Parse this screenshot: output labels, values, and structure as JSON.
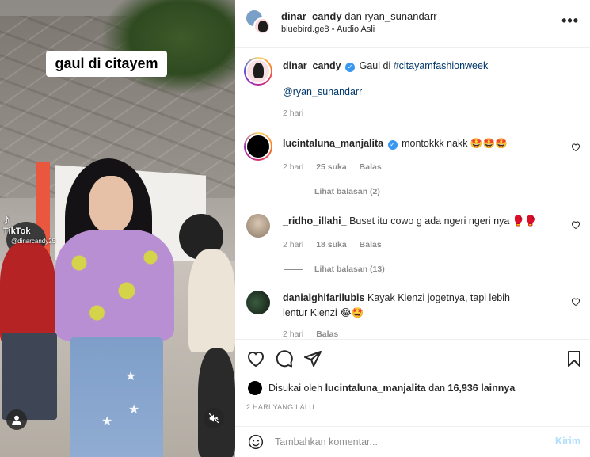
{
  "media": {
    "overlay_text": "gaul di citayem",
    "watermark": "TikTok",
    "watermark_user": "@dinarcandy25",
    "profile_tags_icon": "user-icon",
    "mute_icon": "speaker-muted-icon"
  },
  "header": {
    "user1": "dinar_candy",
    "conjunction": "dan",
    "user2": "ryan_sunandarr",
    "audio_user": "bluebird.ge8",
    "separator": "•",
    "audio_label": "Audio Asli",
    "more_icon": "more-horizontal-icon",
    "more_label": "•••"
  },
  "caption": {
    "username": "dinar_candy",
    "verified": true,
    "verified_icon": "✓",
    "text_before": "Gaul di ",
    "hashtag": "#citayamfashionweek",
    "mention": "@ryan_sunandarr",
    "time": "2 hari"
  },
  "comments": [
    {
      "username": "lucintaluna_manjalita",
      "verified": true,
      "text": "montokkk nakk 🤩🤩🤩",
      "time": "2 hari",
      "likes": "25 suka",
      "reply_label": "Balas",
      "view_replies": "Lihat balasan (2)"
    },
    {
      "username": "_ridho_illahi_",
      "verified": false,
      "text": "Buset itu cowo g ada ngeri ngeri nya 🥊🥊",
      "time": "2 hari",
      "likes": "18 suka",
      "reply_label": "Balas",
      "view_replies": "Lihat balasan (13)"
    },
    {
      "username": "danialghifarilubis",
      "verified": false,
      "text": "Kayak Kienzi jogetnya, tapi lebih lentur Kienzi 😂🤩",
      "time": "2 hari",
      "reply_label": "Balas"
    }
  ],
  "actions": {
    "like_icon": "heart-icon",
    "comment_icon": "comment-icon",
    "share_icon": "paper-plane-icon",
    "save_icon": "bookmark-icon"
  },
  "likes": {
    "prefix": "Disukai oleh ",
    "user": "lucintaluna_manjalita",
    "middle": " dan ",
    "count": "16,936 lainnya"
  },
  "post_date": "2 HARI YANG LALU",
  "add_comment": {
    "emoji_icon": "smiley-icon",
    "placeholder": "Tambahkan komentar...",
    "post_label": "Kirim"
  },
  "colors": {
    "link": "#00376b",
    "verified": "#3897f0",
    "muted": "#8e8e8e",
    "post_disabled": "#b2dffc"
  }
}
